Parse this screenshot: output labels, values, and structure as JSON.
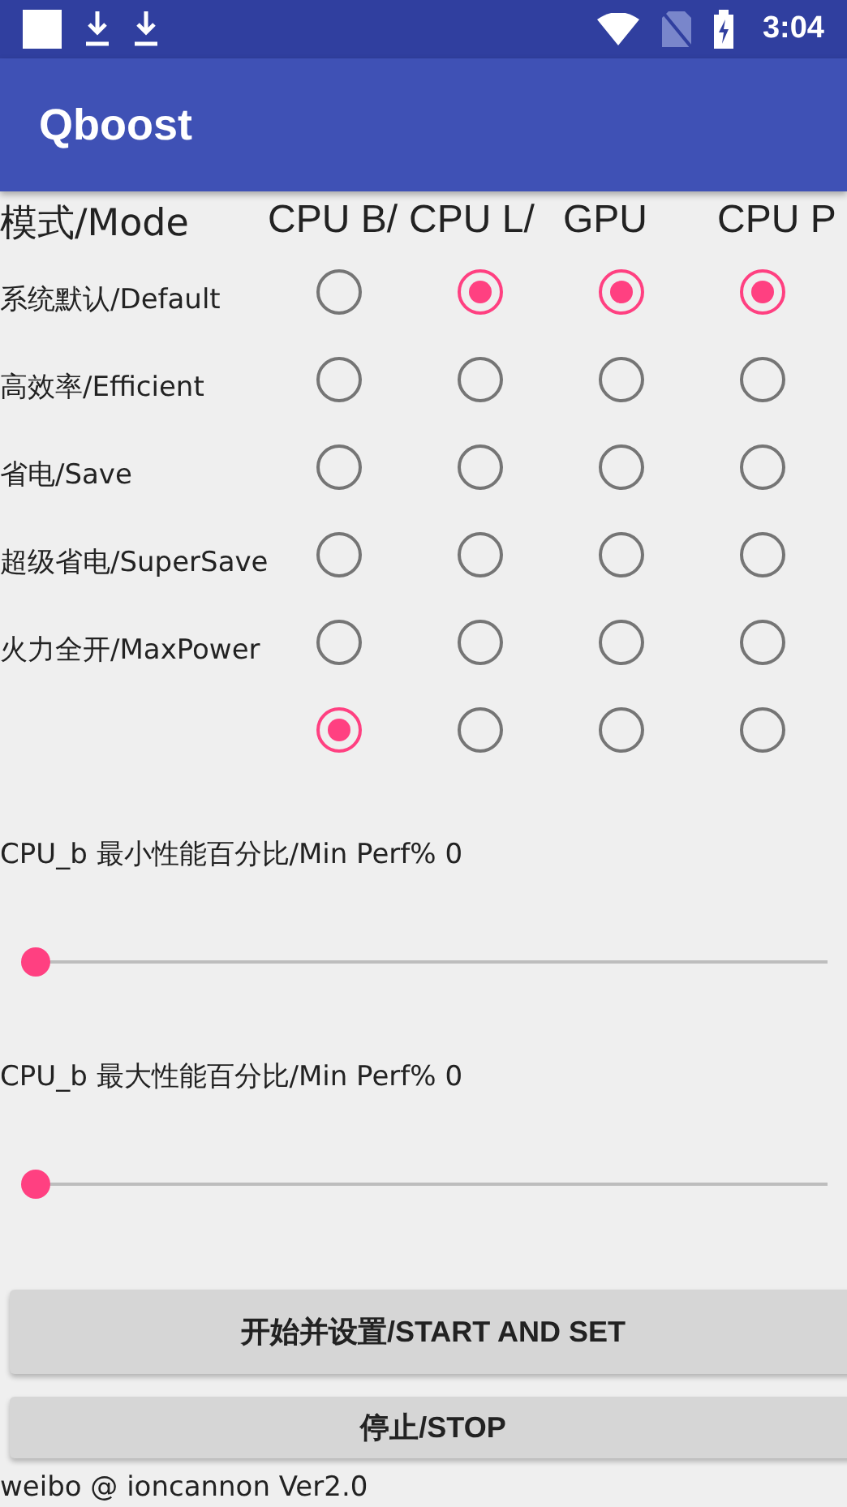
{
  "status_bar": {
    "time": "3:04"
  },
  "app_bar": {
    "title": "Qboost"
  },
  "mode_table": {
    "mode_header": "模式/Mode",
    "columns": [
      "CPU B/",
      "CPU L/",
      "GPU",
      "CPU P"
    ],
    "rows": [
      {
        "label": "系统默认/Default",
        "choices": [
          {
            "selected": false
          },
          {
            "selected": true
          },
          {
            "selected": true
          },
          {
            "selected": true
          }
        ]
      },
      {
        "label": "高效率/Efficient",
        "choices": [
          {
            "selected": false
          },
          {
            "selected": false
          },
          {
            "selected": false
          },
          {
            "selected": false
          }
        ]
      },
      {
        "label": "省电/Save",
        "choices": [
          {
            "selected": false
          },
          {
            "selected": false
          },
          {
            "selected": false
          },
          {
            "selected": false
          }
        ]
      },
      {
        "label": "超级省电/SuperSave",
        "choices": [
          {
            "selected": false
          },
          {
            "selected": false
          },
          {
            "selected": false
          },
          {
            "selected": false
          }
        ]
      },
      {
        "label": "火力全开/MaxPower",
        "choices": [
          {
            "selected": false
          },
          {
            "selected": false
          },
          {
            "selected": false
          },
          {
            "selected": false
          }
        ]
      },
      {
        "choices": [
          {
            "selected": true
          },
          {
            "selected": false
          },
          {
            "selected": false
          },
          {
            "selected": false
          }
        ]
      }
    ]
  },
  "sliders": [
    {
      "label": "CPU_b 最小性能百分比/Min Perf% 0",
      "level": 0
    },
    {
      "label": "CPU_b 最大性能百分比/Min Perf% 0",
      "level": 0
    }
  ],
  "buttons": [
    "开始并设置/START AND SET",
    "停止/STOP"
  ],
  "footer": "weibo @ ioncannon Ver2.0"
}
